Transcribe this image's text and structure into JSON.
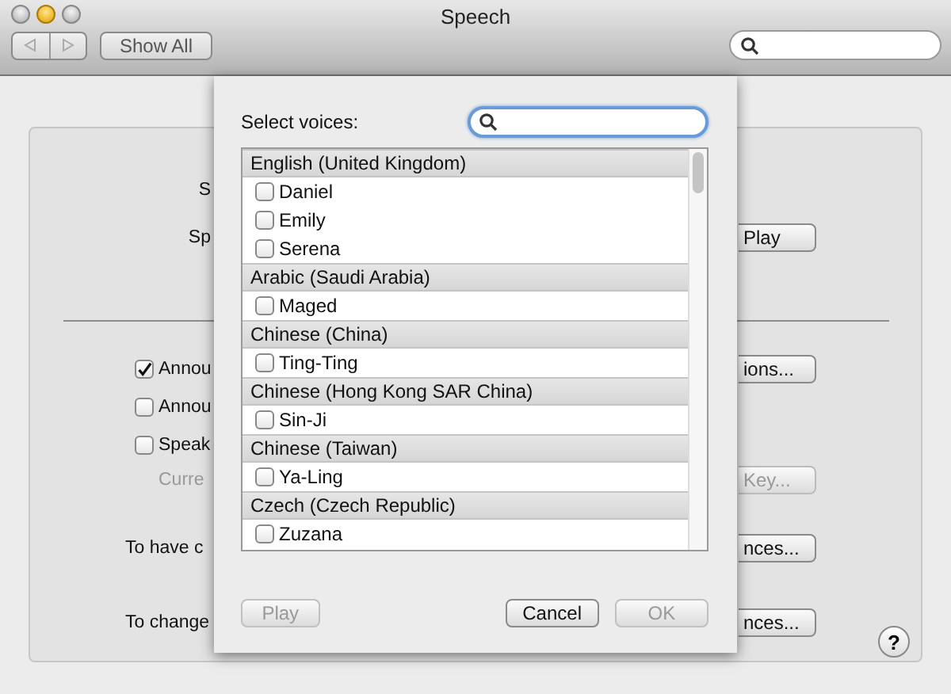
{
  "window": {
    "title": "Speech"
  },
  "toolbar": {
    "nav_disabled": true,
    "show_all": "Show All"
  },
  "pane": {
    "rows": [
      {
        "kind": "label",
        "text": "S",
        "button": null
      },
      {
        "kind": "label",
        "text": "Sp",
        "button": {
          "label": "Play",
          "disabled": false
        }
      },
      {
        "kind": "separator"
      },
      {
        "kind": "checkbox",
        "text": "Annou",
        "checked": true,
        "button": {
          "label": "ions...",
          "disabled": false
        }
      },
      {
        "kind": "checkbox",
        "text": "Annou",
        "checked": false,
        "button": null
      },
      {
        "kind": "checkbox",
        "text": "Speak",
        "checked": false,
        "button": null
      },
      {
        "kind": "subtext",
        "text": "Curre",
        "button": {
          "label": "Key...",
          "disabled": true
        }
      },
      {
        "kind": "text",
        "text": "To have c",
        "button": {
          "label": "nces...",
          "disabled": false
        }
      },
      {
        "kind": "text",
        "text": "To change",
        "button": {
          "label": "nces...",
          "disabled": false
        },
        "help": "?"
      }
    ]
  },
  "sheet": {
    "label": "Select voices:",
    "voices": [
      {
        "kind": "group",
        "text": "English (United Kingdom)"
      },
      {
        "kind": "voice",
        "text": "Daniel",
        "checked": false
      },
      {
        "kind": "voice",
        "text": "Emily",
        "checked": false
      },
      {
        "kind": "voice",
        "text": "Serena",
        "checked": false
      },
      {
        "kind": "group",
        "text": "Arabic (Saudi Arabia)"
      },
      {
        "kind": "voice",
        "text": "Maged",
        "checked": false
      },
      {
        "kind": "group",
        "text": "Chinese (China)"
      },
      {
        "kind": "voice",
        "text": "Ting-Ting",
        "checked": false
      },
      {
        "kind": "group",
        "text": "Chinese (Hong Kong SAR China)"
      },
      {
        "kind": "voice",
        "text": "Sin-Ji",
        "checked": false
      },
      {
        "kind": "group",
        "text": "Chinese (Taiwan)"
      },
      {
        "kind": "voice",
        "text": "Ya-Ling",
        "checked": false
      },
      {
        "kind": "group",
        "text": "Czech (Czech Republic)"
      },
      {
        "kind": "voice",
        "text": "Zuzana",
        "checked": false
      }
    ],
    "buttons": [
      {
        "label": "Play",
        "disabled": true,
        "kind": "left"
      },
      {
        "label": "Cancel",
        "disabled": false,
        "kind": "right"
      },
      {
        "label": "OK",
        "disabled": true,
        "kind": "right"
      }
    ]
  }
}
